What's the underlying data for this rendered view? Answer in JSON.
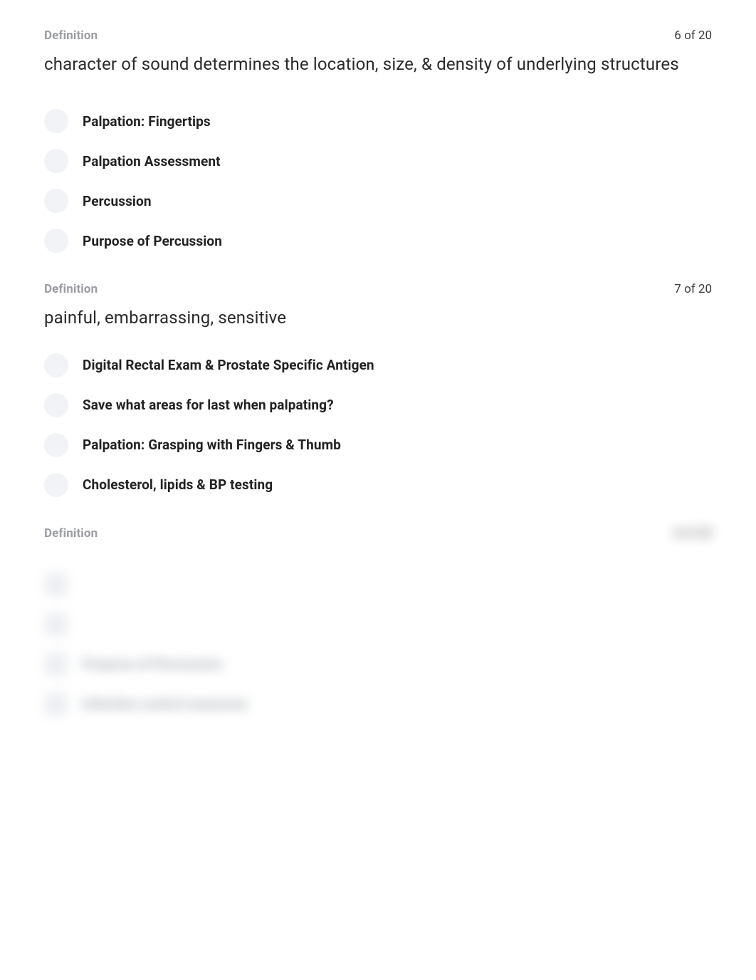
{
  "questions": [
    {
      "label": "Definition",
      "counter": "6 of 20",
      "text": "character of sound determines the location, size, & density of underlying structures",
      "options": [
        "Palpation: Fingertips",
        "Palpation Assessment",
        "Percussion",
        "Purpose of Percussion"
      ]
    },
    {
      "label": "Definition",
      "counter": "7 of 20",
      "text": "painful, embarrassing, sensitive",
      "options": [
        "Digital Rectal Exam & Prostate Specific Antigen",
        "Save what areas for last when palpating?",
        "Palpation: Grasping with Fingers & Thumb",
        "Cholesterol, lipids & BP testing"
      ]
    }
  ],
  "locked": {
    "label": "Definition",
    "counter_hidden": "8 of 20",
    "options": [
      "",
      "",
      "Purpose of Percussion",
      "Infection control measures"
    ]
  }
}
